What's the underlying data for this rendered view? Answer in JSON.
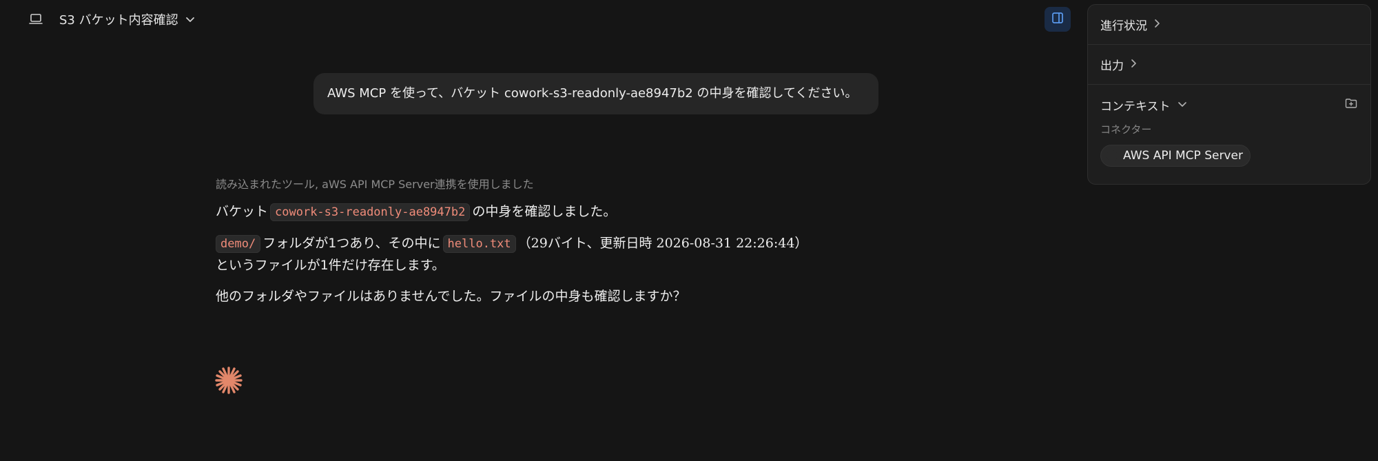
{
  "header": {
    "title": "S3 バケット内容確認"
  },
  "chat": {
    "user_message": "AWS MCP を使って、バケット cowork-s3-readonly-ae8947b2 の中身を確認してください。",
    "tool_note": "読み込まれたツール, aWS API MCP Server連携を使用しました",
    "p1_before": "バケット",
    "p1_code": "cowork-s3-readonly-ae8947b2",
    "p1_after": "の中身を確認しました。",
    "p2_code1": "demo/",
    "p2_mid": "フォルダが1つあり、その中に",
    "p2_code2": "hello.txt",
    "p2_after": "（29バイト、更新日時 2026-08-31 22:26:44）",
    "p2_line2": "というファイルが1件だけ存在します。",
    "p3": "他のフォルダやファイルはありませんでした。ファイルの中身も確認しますか？"
  },
  "panel": {
    "progress_label": "進行状況",
    "output_label": "出力",
    "context_label": "コンテキスト",
    "connector_section": "コネクター",
    "connector_name": "AWS API MCP Server"
  },
  "colors": {
    "accent": "#E2876A",
    "code_text": "#F08C7A",
    "toggle_bg": "#1A2B45",
    "toggle_icon": "#5B9BF0"
  }
}
